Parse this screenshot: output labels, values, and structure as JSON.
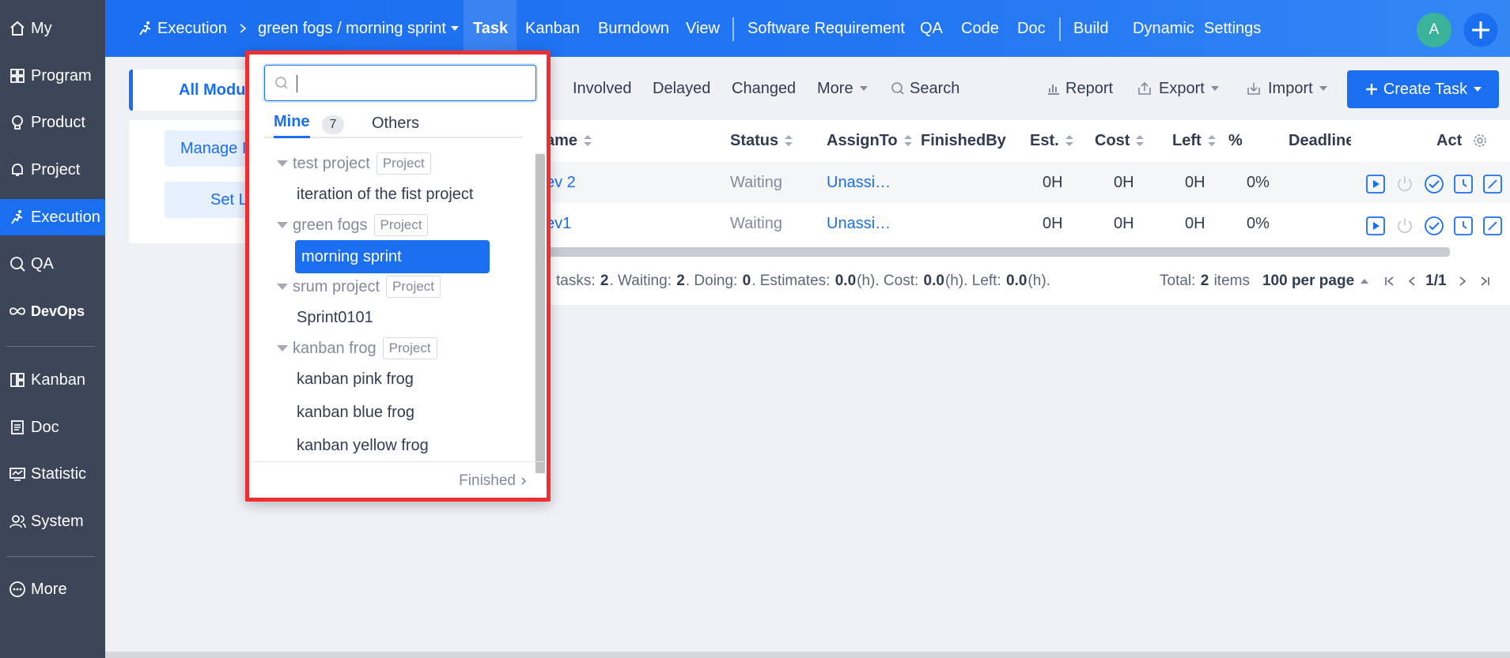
{
  "sidebar": {
    "items": [
      {
        "label": "My",
        "icon": "home-icon"
      },
      {
        "label": "Program",
        "icon": "grid-icon"
      },
      {
        "label": "Product",
        "icon": "bulb-icon"
      },
      {
        "label": "Project",
        "icon": "bell-icon"
      },
      {
        "label": "Execution",
        "icon": "runner-icon",
        "active": true
      },
      {
        "label": "QA",
        "icon": "magnifier-icon"
      },
      {
        "label": "DevOps",
        "icon": "infinity-icon"
      },
      {
        "label": "Kanban",
        "icon": "kanban-icon"
      },
      {
        "label": "Doc",
        "icon": "doc-icon"
      },
      {
        "label": "Statistic",
        "icon": "monitor-icon"
      },
      {
        "label": "System",
        "icon": "users-icon"
      },
      {
        "label": "More",
        "icon": "more-icon"
      }
    ]
  },
  "header": {
    "execution": "Execution",
    "breadcrumb": "green fogs / morning sprint",
    "nav": [
      "Task",
      "Kanban",
      "Burndown",
      "View",
      "Software Requirement",
      "QA",
      "Code",
      "Doc",
      "Build",
      "Dynamic",
      "Settings"
    ],
    "avatar_letter": "A"
  },
  "modules": {
    "tab_label": "All Modu",
    "manage_label": "Manage I",
    "set_label": "Set L"
  },
  "toolbar": {
    "involved": "Involved",
    "delayed": "Delayed",
    "changed": "Changed",
    "more": "More",
    "search": "Search",
    "report": "Report",
    "export": "Export",
    "import": "Import",
    "create_task": "Create Task"
  },
  "table": {
    "columns": [
      "ame",
      "Status",
      "AssignTo",
      "FinishedBy",
      "Est.",
      "Cost",
      "Left",
      "%",
      "Deadline",
      "Act"
    ],
    "rows": [
      {
        "name": "ev 2",
        "status": "Waiting",
        "assign": "Unassi…",
        "est": "0H",
        "cost": "0H",
        "left": "0H",
        "pct": "0%"
      },
      {
        "name": "ev1",
        "status": "Waiting",
        "assign": "Unassi…",
        "est": "0H",
        "cost": "0H",
        "left": "0H",
        "pct": "0%"
      }
    ]
  },
  "footer": {
    "summary_prefix": "tasks:",
    "tasks": "2",
    "waiting_label": ". Waiting:",
    "waiting": "2",
    "doing_label": ". Doing:",
    "doing": "0",
    "est_label": ". Estimates:",
    "estimates": "0.0",
    "cost_label": "(h). Cost:",
    "cost": "0.0",
    "left_label": "(h). Left:",
    "left": "0.0",
    "suffix": "(h).",
    "total_label": "Total:",
    "total": "2",
    "items_label": "items",
    "per_page": "100 per page",
    "page": "1/1"
  },
  "dropdown": {
    "search_placeholder": "",
    "tab_mine": "Mine",
    "mine_count": "7",
    "tab_others": "Others",
    "project_tag": "Project",
    "groups": [
      {
        "name": "test project",
        "items": [
          "iteration of the fist project"
        ]
      },
      {
        "name": "green fogs",
        "items": [
          "morning sprint"
        ]
      },
      {
        "name": "srum project",
        "items": [
          "Sprint0101"
        ]
      },
      {
        "name": "kanban frog",
        "items": [
          "kanban pink frog",
          "kanban blue frog",
          "kanban yellow frog"
        ]
      }
    ],
    "finished": "Finished"
  },
  "colors": {
    "accent": "#1a6ef0",
    "sidebar": "#3d4658",
    "highlight_border": "#ee2f32"
  }
}
